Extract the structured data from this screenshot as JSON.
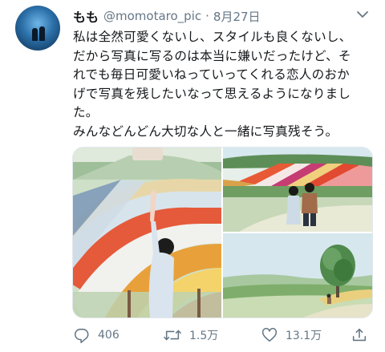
{
  "user": {
    "name": "もも",
    "handle": "@momotaro_pic",
    "separator": "·",
    "date": "8月27日"
  },
  "tweet": {
    "lines": [
      "私は全然可愛くないし、スタイルも良くないし、",
      "だから写真に写るのは本当に嫌いだったけど、そ",
      "れでも毎日可愛いねっていってくれる恋人のおか",
      "げで写真を残したいなって思えるようになりまし",
      "た。",
      "みんなどんどん大切な人と一緒に写真残そう。"
    ]
  },
  "actions": {
    "reply_count": "406",
    "retweet_count": "1.5万",
    "like_count": "13.1万"
  },
  "icons": {
    "reply": "reply-icon",
    "retweet": "retweet-icon",
    "like": "heart-icon",
    "share": "share-icon",
    "more": "chevron-down-icon"
  },
  "colors": {
    "text": "#14171a",
    "secondary": "#657786",
    "border": "#e1e8ed"
  }
}
